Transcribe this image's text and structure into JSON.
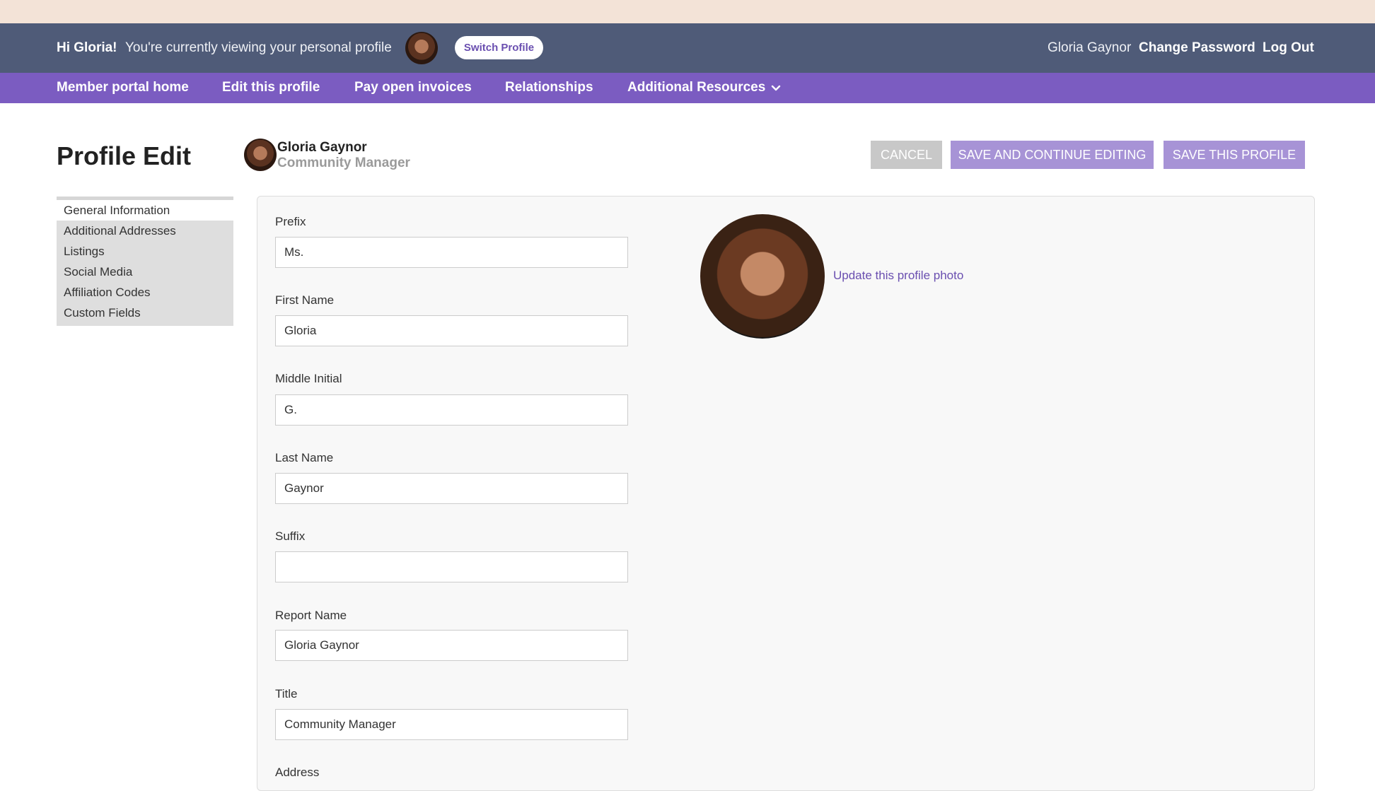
{
  "header": {
    "greeting": "Hi Gloria!",
    "viewing_text": "You're currently viewing your personal profile",
    "switch_label": "Switch Profile",
    "user_name": "Gloria Gaynor",
    "change_password": "Change Password",
    "logout": "Log Out"
  },
  "nav": {
    "items": [
      "Member portal home",
      "Edit this profile",
      "Pay open invoices",
      "Relationships",
      "Additional Resources"
    ]
  },
  "page": {
    "title": "Profile Edit",
    "profile_name": "Gloria Gaynor",
    "profile_title": "Community Manager"
  },
  "actions": {
    "cancel": "CANCEL",
    "save_continue": "SAVE AND CONTINUE EDITING",
    "save": "SAVE THIS PROFILE"
  },
  "sidebar": {
    "items": [
      "General Information",
      "Additional Addresses",
      "Listings",
      "Social Media",
      "Affiliation Codes",
      "Custom Fields"
    ],
    "active_index": 0
  },
  "form": {
    "fields": [
      {
        "label": "Prefix",
        "value": "Ms."
      },
      {
        "label": "First Name",
        "value": "Gloria"
      },
      {
        "label": "Middle Initial",
        "value": "G."
      },
      {
        "label": "Last Name",
        "value": "Gaynor"
      },
      {
        "label": "Suffix",
        "value": ""
      },
      {
        "label": "Report Name",
        "value": "Gloria Gaynor"
      },
      {
        "label": "Title",
        "value": "Community Manager"
      },
      {
        "label": "Address",
        "value": ""
      }
    ],
    "update_photo": "Update this profile photo"
  },
  "colors": {
    "top_strip": "#f3e3d7",
    "header_bg": "#4f5b78",
    "nav_bg": "#7b5cc1",
    "accent": "#6a4fb0",
    "primary_button": "#a793d6",
    "cancel_button": "#c8c8c8"
  },
  "icons": {
    "dropdown": "chevron-down-icon"
  }
}
